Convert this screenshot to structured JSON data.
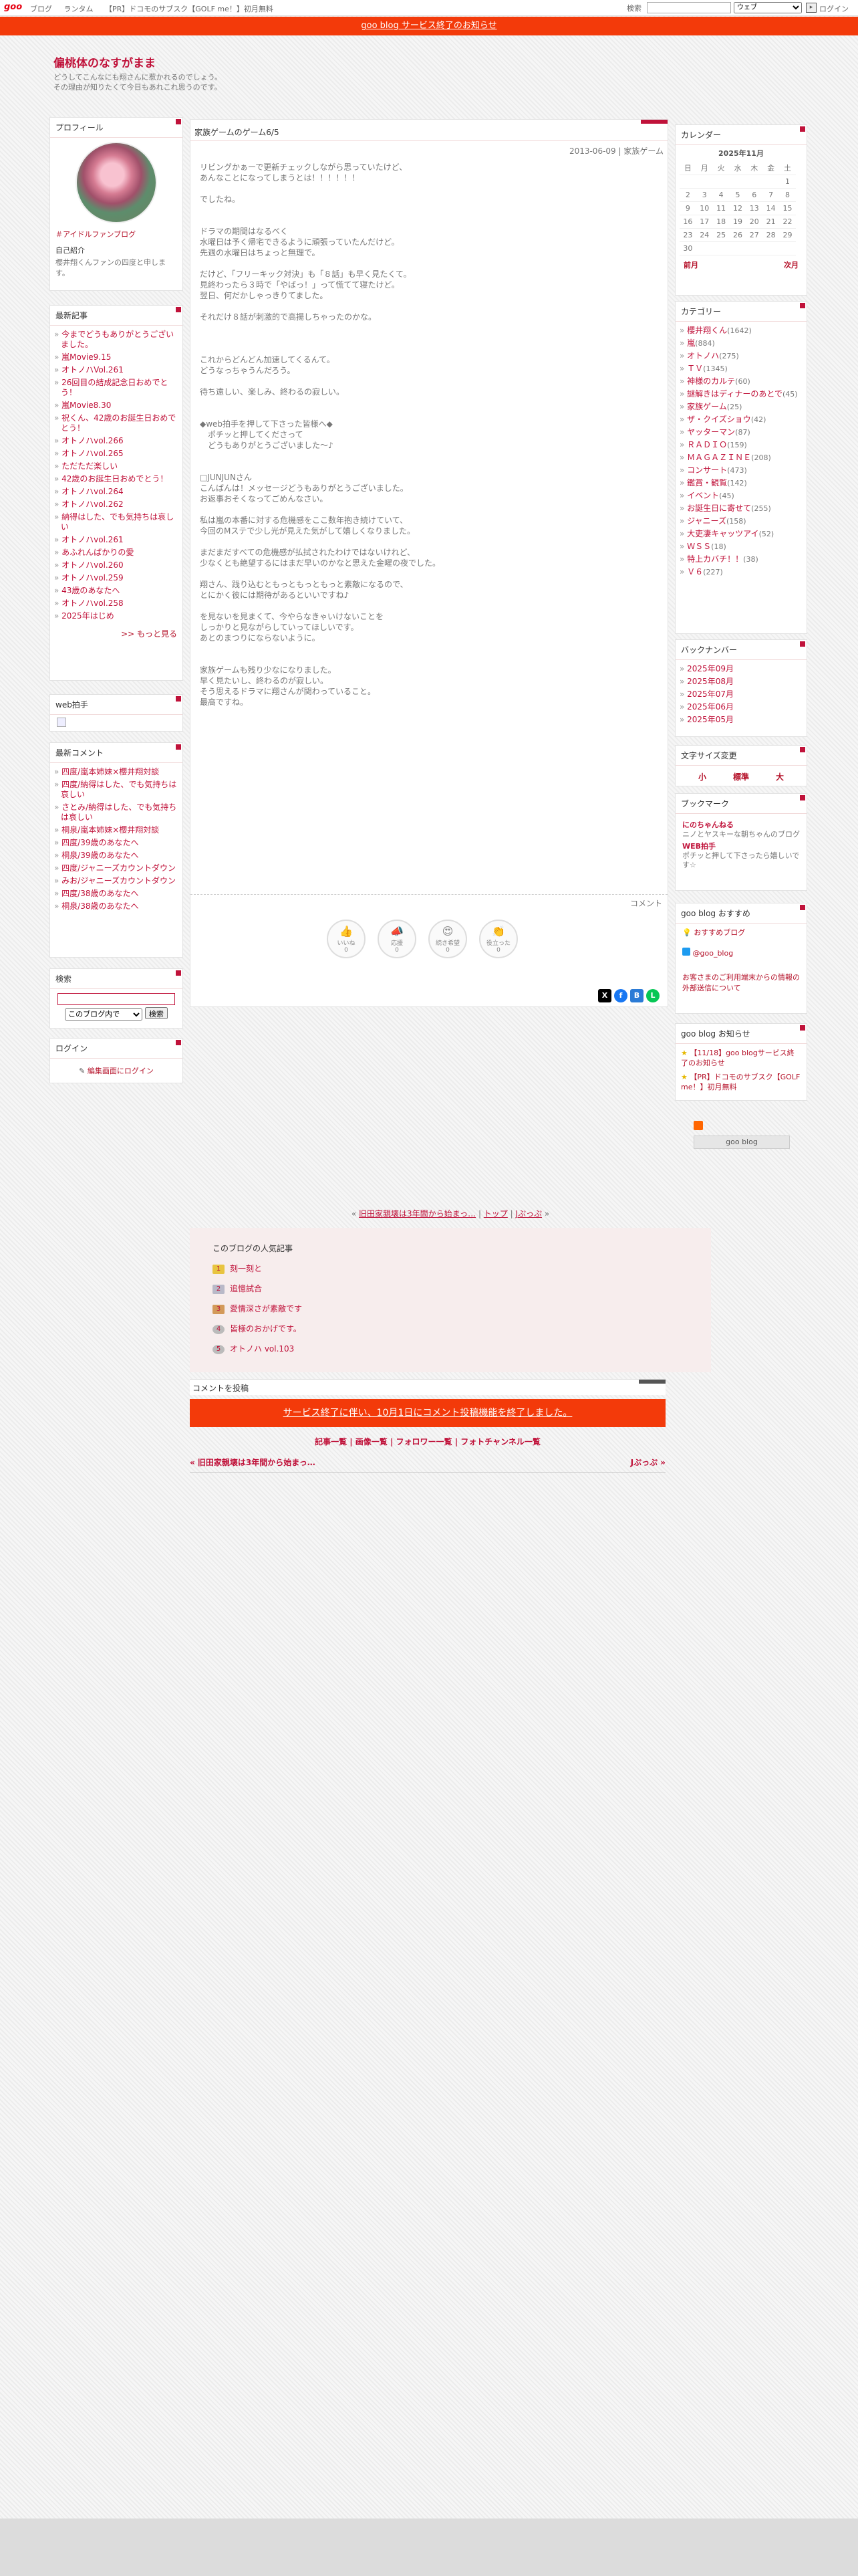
{
  "topbar": {
    "logo": "goo",
    "links": [
      "ブログ",
      "ランタム",
      "【PR】ドコモのサブスク【GOLF me！】初月無料"
    ],
    "search_label": "検索",
    "search_scope": "ウェブ",
    "login": "ログイン"
  },
  "notice": "goo blog サービス終了のお知らせ",
  "blog": {
    "title": "偏桃体のなすがまま",
    "desc1": "どうしてこんなにも翔さんに惹かれるのでしょう。",
    "desc2": "その理由が知りたくて今日もあれこれ思うのです。"
  },
  "profile": {
    "header": "プロフィール",
    "link": "＃アイドルファンブログ",
    "intro_label": "自己紹介",
    "intro": "櫻井翔くんファンの四度と申します。"
  },
  "recent": {
    "header": "最新記事",
    "items": [
      "今までどうもありがとうございました。",
      "嵐Movie9.15",
      "オトノハVol.261",
      "26回目の結成記念日おめでとう！",
      "嵐Movie8.30",
      "祝くん、42歳のお誕生日おめでとう！",
      "オトノハvol.266",
      "オトノハvol.265",
      "ただただ楽しい",
      "42歳のお誕生日おめでとう！",
      "オトノハvol.264",
      "オトノハvol.262",
      "納得はした、でも気持ちは哀しい",
      "オトノハvol.261",
      "あふれんばかりの愛",
      "オトノハvol.260",
      "オトノハvol.259",
      "43歳のあなたへ",
      "オトノハvol.258",
      "2025年はじめ"
    ],
    "more": ">> もっと見る"
  },
  "webclap": {
    "header": "web拍手"
  },
  "comments": {
    "header": "最新コメント",
    "items": [
      "四度/嵐本姉妹×櫻井翔対談",
      "四度/納得はした、でも気持ちは哀しい",
      "さとみ/納得はした、でも気持ちは哀しい",
      "桐泉/嵐本姉妹×櫻井翔対談",
      "四度/39歳のあなたへ",
      "桐泉/39歳のあなたへ",
      "四度/ジャニーズカウントダウン",
      "みお/ジャニーズカウントダウン",
      "四度/38歳のあなたへ",
      "桐泉/38歳のあなたへ"
    ]
  },
  "search": {
    "header": "検索",
    "scope": "このブログ内で",
    "button": "検索"
  },
  "login": {
    "header": "ログイン",
    "link": "編集画面にログイン"
  },
  "post": {
    "title": "家族ゲームのゲーム6/5",
    "meta": "2013-06-09 | 家族ゲーム",
    "body": "リビングかぁーで更新チェックしながら思っていたけど、\nあんなことになってしまうとは！！！！！！\n\nでしたね。\n\n\nドラマの期間はなるべく\n水曜日は予く帰宅できるように頑張っていたんだけど。\n先週の水曜日はちょっと無理で。\n\nだけど、「フリーキック対決」も「８話」も早く見たくて。\n見終わったら３時で「やばっ！」って慌てて寝たけど。\n翌日、何だかしゃっきりてました。\n\nそれだけ８話が刺激的で高揚しちゃったのかな。\n\n\n\nこれからどんどん加速してくるんて。\nどうなっちゃうんだろう。\n\n待ち遠しい、楽しみ、終わるの寂しい。\n\n\n◆web拍手を押して下さった皆様へ◆\n　ポチッと押してくださって\n　どうもありがとうございました～♪\n\n\n□JUNJUNさん\nこんばんは！メッセージどうもありがとうございました。\nお返事おそくなってごめんなさい。\n\n私は嵐の本番に対する危機感をここ数年抱き続けていて、\n今回のMステで少し光が見えた気がして嬉しくなりました。\n\nまだまだすべての危機感が払拭されたわけではないけれど、\n少なくとも絶望するにはまだ早いのかなと思えた金曜の夜でした。\n\n翔さん、践り込むともっともっともっと素敵になるので、\nとにかく彼には期待があるといいですね♪\n\nを見ないを見まくて、今やらなきゃいけないことを\nしっかりと見ながらしていってほしいです。\nあとのまつりにならないように。\n\n\n家族ゲームも残り少なになりました。\n早く見たいし、終わるのが寂しい。\nそう思えるドラマに翔さんが関わっていること。\n最高ですね。",
    "comment_label": "コメント",
    "reactions": [
      {
        "label": "いいね",
        "icon": "👍",
        "count": "0"
      },
      {
        "label": "応援",
        "icon": "📣",
        "count": "0"
      },
      {
        "label": "続き希望",
        "icon": "😍",
        "count": "0"
      },
      {
        "label": "役立った",
        "icon": "👏",
        "count": "0"
      }
    ]
  },
  "calendar": {
    "header": "カレンダー",
    "month": "2025年11月",
    "days": [
      "日",
      "月",
      "火",
      "水",
      "木",
      "金",
      "土"
    ],
    "weeks": [
      [
        "",
        "",
        "",
        "",
        "",
        "",
        "1"
      ],
      [
        "2",
        "3",
        "4",
        "5",
        "6",
        "7",
        "8"
      ],
      [
        "9",
        "10",
        "11",
        "12",
        "13",
        "14",
        "15"
      ],
      [
        "16",
        "17",
        "18",
        "19",
        "20",
        "21",
        "22"
      ],
      [
        "23",
        "24",
        "25",
        "26",
        "27",
        "28",
        "29"
      ],
      [
        "30",
        "",
        "",
        "",
        "",
        "",
        ""
      ]
    ],
    "prev": "前月",
    "next": "次月"
  },
  "categories": {
    "header": "カテゴリー",
    "items": [
      [
        "櫻井翔くん",
        "(1642)"
      ],
      [
        "嵐",
        "(884)"
      ],
      [
        "オトノハ",
        "(275)"
      ],
      [
        "ＴＶ",
        "(1345)"
      ],
      [
        "神様のカルテ",
        "(60)"
      ],
      [
        "謎解きはディナーのあとで",
        "(45)"
      ],
      [
        "家族ゲーム",
        "(25)"
      ],
      [
        "ザ・クイズショウ",
        "(42)"
      ],
      [
        "ヤッターマン",
        "(87)"
      ],
      [
        "ＲＡＤＩＯ",
        "(159)"
      ],
      [
        "ＭＡＧＡＺＩＮＥ",
        "(208)"
      ],
      [
        "コンサート",
        "(473)"
      ],
      [
        "鑑賞・観覧",
        "(142)"
      ],
      [
        "イベント",
        "(45)"
      ],
      [
        "お誕生日に寄せて",
        "(255)"
      ],
      [
        "ジャニーズ",
        "(158)"
      ],
      [
        "大吏凄キャッツアイ",
        "(52)"
      ],
      [
        "ＷＳＳ",
        "(18)"
      ],
      [
        "特上カバチ！！",
        "(38)"
      ],
      [
        "Ｖ６",
        "(227)"
      ]
    ]
  },
  "backnumber": {
    "header": "バックナンバー",
    "items": [
      "2025年09月",
      "2025年08月",
      "2025年07月",
      "2025年06月",
      "2025年05月"
    ]
  },
  "fontsize": {
    "header": "文字サイズ変更",
    "small": "小",
    "normal": "標準",
    "large": "大"
  },
  "bookmark": {
    "header": "ブックマーク",
    "items": [
      {
        "name": "にのちゃんねる",
        "desc": "ニノとヤスキーな朝ちゃんのブログ"
      },
      {
        "name": "WEB拍手",
        "desc": "ポチッと押して下さったら嬉しいです☆"
      }
    ]
  },
  "goo_reco": {
    "header": "goo blog おすすめ",
    "items": [
      "おすすめブログ",
      "@goo_blog",
      "お客さまのご利用端末からの情報の外部送信について"
    ]
  },
  "goo_notice": {
    "header": "goo blog お知らせ",
    "items": [
      "【11/18】goo blogサービス終了のお知らせ",
      "【PR】ドコモのサブスク【GOLF me！】初月無料"
    ]
  },
  "footer_logo": "goo blog",
  "nav": {
    "prev": "旧田家親壊は3年間から始まっ…",
    "top": "トップ",
    "next": "Jぷっぷ"
  },
  "ranking": {
    "header": "このブログの人気記事",
    "items": [
      "刻一刻と",
      "追憶試合",
      "愛情深さが素敵です",
      "皆様のおかげです。",
      "オトノハ vol.103"
    ]
  },
  "comment_post": {
    "header": "コメントを投稿",
    "end": "サービス終了に伴い、10月1日にコメント投稿機能を終了しました。"
  },
  "footer_links": "記事一覧 | 画像一覧 | フォロワー一覧 | フォトチャンネル一覧",
  "footer_nav": {
    "prev": "« 旧田家親壊は3年間から始まっ…",
    "next": "Jぷっぷ »"
  },
  "colors": {
    "accent": "#c0123a",
    "notice": "#f33a0a"
  }
}
